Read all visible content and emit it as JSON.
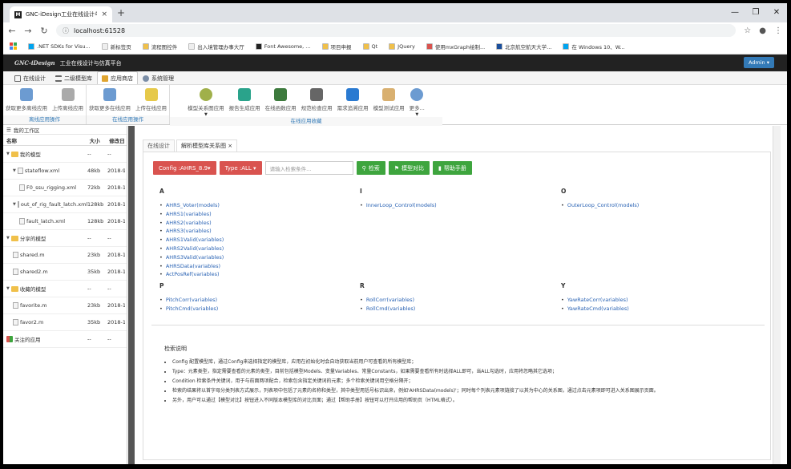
{
  "browser": {
    "tab_title": "GNC-iDesign工业在线设计与仿",
    "url": "localhost:61528",
    "bookmarks": [
      ".NET SDKs for Visu...",
      "新标签页",
      "流程图控件",
      "出入境管理办事大厅",
      "Font Awesome, ...",
      "项目申报",
      "Qt",
      "JQuery",
      "使用mxGraph绘制...",
      "北京航空航天大学...",
      "在 Windows 10、W..."
    ]
  },
  "app": {
    "brand_logo": "GNC-iDesign",
    "brand_text": "工业在线设计与仿真平台",
    "admin": "Admin"
  },
  "module_tabs": [
    "在线设计",
    "二级模型库",
    "应用商店",
    "系统管理"
  ],
  "ribbon": {
    "groups": [
      {
        "label": "离线应用操作",
        "buttons": [
          "获取更多离线应用",
          "上传离线应用"
        ]
      },
      {
        "label": "在线应用操作",
        "buttons": [
          "获取更多在线应用",
          "上传在线应用"
        ]
      },
      {
        "label": "在线应用收藏",
        "buttons": [
          "模型关系图应用",
          "报告生成应用",
          "在线函数应用",
          "规范检查应用",
          "需求追溯应用",
          "模型测试应用",
          "更多..."
        ]
      }
    ]
  },
  "workspace": {
    "title": "我的工作区",
    "headers": {
      "name": "名称",
      "size": "大小",
      "date": "修改日"
    },
    "rows": [
      {
        "name": "我的模型",
        "size": "--",
        "date": "--",
        "type": "folder",
        "indent": 0
      },
      {
        "name": "stateflow.xml",
        "size": "48kb",
        "date": "2018-9",
        "type": "file",
        "indent": 1
      },
      {
        "name": "F0_ssu_rigging.xml",
        "size": "72kb",
        "date": "2018-1",
        "type": "file",
        "indent": 2
      },
      {
        "name": "out_of_rig_fault_latch.xml",
        "size": "128kb",
        "date": "2018-1",
        "type": "file",
        "indent": 1
      },
      {
        "name": "fault_latch.xml",
        "size": "128kb",
        "date": "2018-1",
        "type": "file",
        "indent": 2
      },
      {
        "name": "分享的模型",
        "size": "--",
        "date": "--",
        "type": "folder",
        "indent": 0
      },
      {
        "name": "shared.m",
        "size": "23kb",
        "date": "2018-1",
        "type": "file",
        "indent": 1
      },
      {
        "name": "shared2.m",
        "size": "35kb",
        "date": "2018-1",
        "type": "file",
        "indent": 1
      },
      {
        "name": "收藏的模型",
        "size": "--",
        "date": "--",
        "type": "folder",
        "indent": 0
      },
      {
        "name": "favorite.m",
        "size": "23kb",
        "date": "2018-1",
        "type": "file",
        "indent": 1
      },
      {
        "name": "favor2.m",
        "size": "35kb",
        "date": "2018-1",
        "type": "file",
        "indent": 1
      },
      {
        "name": "关注的应用",
        "size": "--",
        "date": "--",
        "type": "app",
        "indent": 0
      }
    ]
  },
  "content_tabs": [
    "在线设计",
    "解析模型库关系图 ×"
  ],
  "toolbar": {
    "config": "Config :AHRS_8.9▾",
    "type": "Type :ALL ▾",
    "search_placeholder": "请输入检索条件...",
    "search_btn": "检索",
    "compare_btn": "模型对比",
    "help_btn": "帮助手册"
  },
  "index": [
    {
      "letter": "A",
      "items": [
        "AHRS_Voter(models)",
        "AHRS1(variables)",
        "AHRS2(variables)",
        "AHRS3(variables)",
        "AHRS1Valid(variables)",
        "AHRS2Valid(variables)",
        "AHRS3Valid(variables)",
        "AHRSData(variables)",
        "ActPosRef(variables)"
      ]
    },
    {
      "letter": "I",
      "items": [
        "InnerLoop_Control(models)"
      ]
    },
    {
      "letter": "O",
      "items": [
        "OuterLoop_Control(models)"
      ]
    },
    {
      "letter": "P",
      "items": [
        "PitchCorr(variables)",
        "PitchCmd(variables)"
      ]
    },
    {
      "letter": "R",
      "items": [
        "RollCorr(variables)",
        "RollCmd(variables)"
      ]
    },
    {
      "letter": "Y",
      "items": [
        "YawRateCorr(variables)",
        "YawRateCmd(variables)"
      ]
    }
  ],
  "help": {
    "title": "检索说明",
    "items": [
      "Config 配置模型库，通过Config来选择指定的模型库，应用在初始化时会自动获取当前用户可查看的所有模型库；",
      "Type：元素类型，指定需要查看的元素的类型，目前包括模型Models、变量Variables、常量Constants，如果需要查看所有时选择ALL即可，当ALL勾选时，应用将忽略其它选项；",
      "Condition 检索条件关键词，用于与前面两项配合，检索包含指定关键词的元素；多个检索关键词用空格分隔开；",
      "检索的结果将以首字母分类列表方式展示，列表项中包括了元素的名称和类型，其中类型用括号标识出来，例如'AHRSData(models)'；同时每个列表元素项链接了以其为中心的关系图，通过点击元素项即可进入关系图展示页面。",
      "另外，用户可以通过【模型对比】按钮进入不同版本模型库的对比页面；通过【帮助手册】按钮可以打开应用的帮助页（HTML格式）。"
    ]
  }
}
